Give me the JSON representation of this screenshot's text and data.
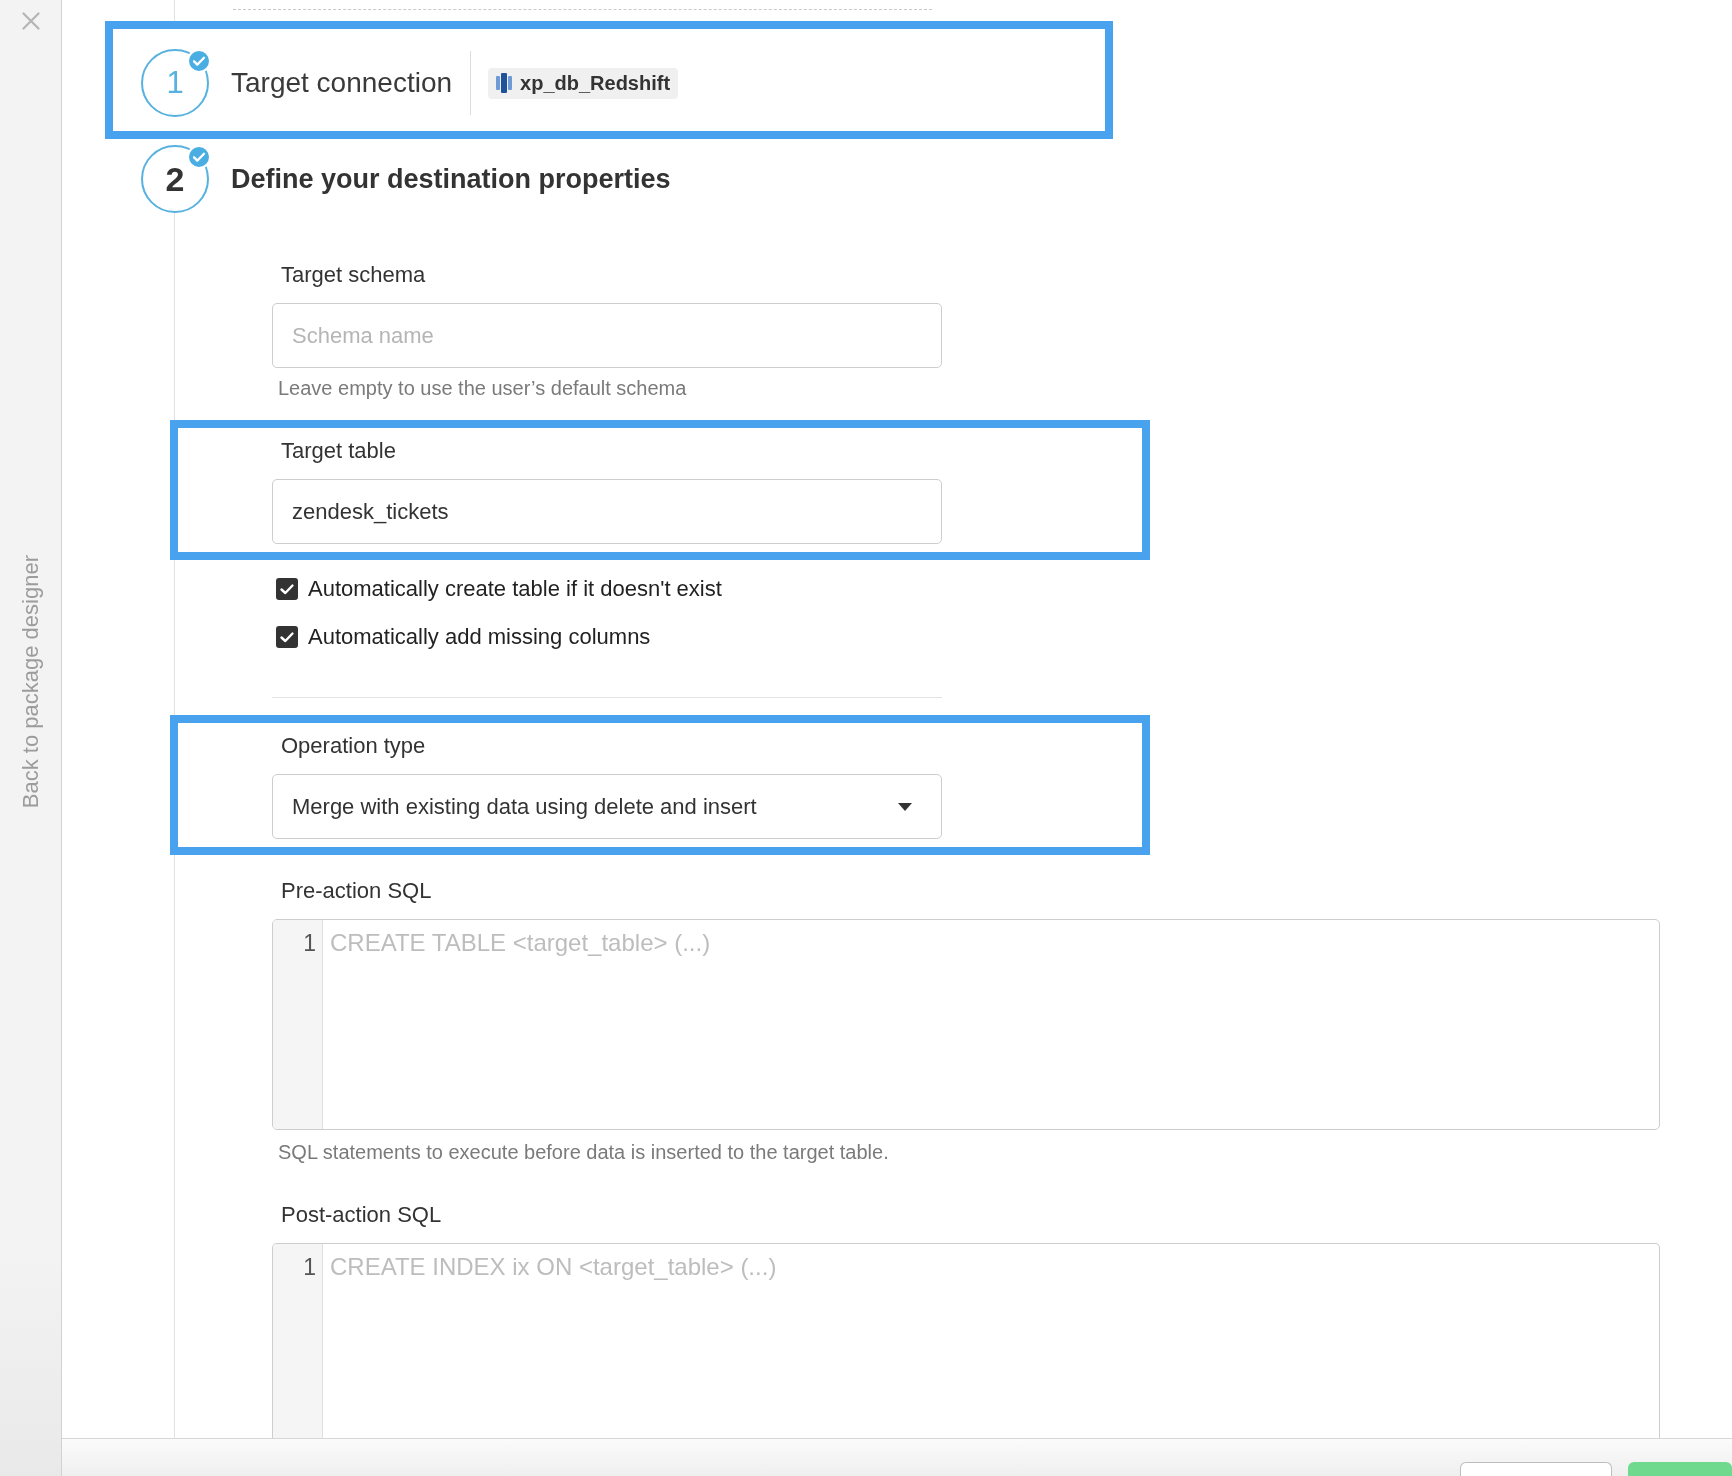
{
  "sidebar": {
    "back_link": "Back to package designer"
  },
  "steps": [
    {
      "number": "1",
      "title": "Target connection",
      "active": false,
      "completed": true,
      "highlighted": true,
      "connection": "xp_db_Redshift"
    },
    {
      "number": "2",
      "title": "Define your destination properties",
      "active": true,
      "completed": true,
      "highlighted": false
    }
  ],
  "sections": [
    {
      "fields": [
        {
          "kind": "text",
          "label": "Target schema",
          "placeholder": "Schema name",
          "hint": "Leave empty to use the user’s default schema",
          "highlighted": false
        },
        {
          "kind": "text",
          "label": "Target table",
          "value": "zendesk_tickets",
          "highlighted": true
        },
        {
          "kind": "checkbox",
          "label": "Automatically create table if it doesn't exist",
          "checked": true,
          "highlighted": false
        },
        {
          "kind": "checkbox",
          "label": "Automatically add missing columns",
          "checked": true,
          "highlighted": false
        }
      ]
    },
    {
      "fields": [
        {
          "kind": "select",
          "label": "Operation type",
          "value": "Merge with existing data using delete and insert",
          "highlighted": true
        },
        {
          "kind": "code",
          "label": "Pre-action SQL",
          "line_numbers": [
            "1"
          ],
          "placeholder": "CREATE TABLE <target_table> (...)",
          "hint": "SQL statements to execute before data is inserted to the target table.",
          "highlighted": false
        },
        {
          "kind": "code",
          "label": "Post-action SQL",
          "line_numbers": [
            "1"
          ],
          "placeholder": "CREATE INDEX ix ON <target_table> (...)",
          "highlighted": false
        }
      ]
    }
  ],
  "footer": {
    "buttons": [
      {
        "kind": "secondary"
      },
      {
        "kind": "primary"
      }
    ]
  }
}
